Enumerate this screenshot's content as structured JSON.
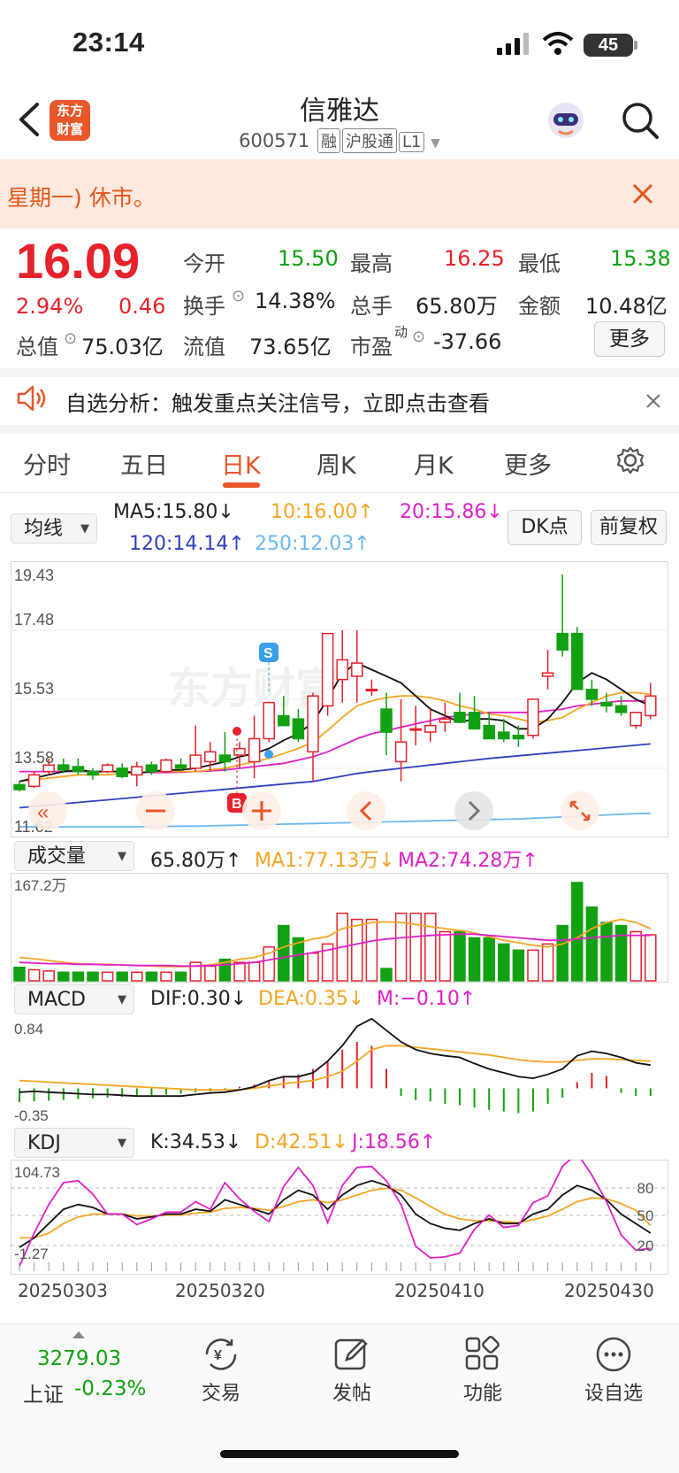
{
  "status_bar": {
    "time": "23:14",
    "battery": "45"
  },
  "header": {
    "stock_name": "信雅达",
    "stock_code": "600571",
    "tags": [
      "融",
      "沪股通",
      "L1"
    ],
    "logo_text_1": "东方",
    "logo_text_2": "财富"
  },
  "notice": {
    "text": "星期一) 休市。"
  },
  "quote": {
    "price": "16.09",
    "change_pct": "2.94%",
    "change_amt": "0.46",
    "open_label": "今开",
    "open": "15.50",
    "high_label": "最高",
    "high": "16.25",
    "low_label": "最低",
    "low": "15.38",
    "turnover_label": "换手",
    "turnover": "14.38%",
    "volume_label": "总手",
    "volume": "65.80万",
    "amount_label": "金额",
    "amount": "10.48亿",
    "mktcap_label": "总值",
    "mktcap": "75.03亿",
    "float_label": "流值",
    "float": "73.65亿",
    "pe_label": "市盈",
    "pe_sup": "动",
    "pe": "-37.66",
    "more_label": "更多"
  },
  "analysis": {
    "text": "自选分析：触发重点关注信号，立即点击查看"
  },
  "tabs": [
    "分时",
    "五日",
    "日K",
    "周K",
    "月K",
    "更多"
  ],
  "active_tab": "日K",
  "indicator_bar": {
    "selector": "均线",
    "ma5": "MA5:15.80↓",
    "ma10": "10:16.00↑",
    "ma20": "20:15.86↓",
    "ma120": "120:14.14↑",
    "ma250": "250:12.03↑",
    "dk_button": "DK点",
    "fq_button": "前复权"
  },
  "colors": {
    "up": "#e8212a",
    "down": "#12a112",
    "ma5": "#111111",
    "ma10": "#f5a623",
    "ma20": "#e020c8",
    "ma120": "#3040c0",
    "ma250": "#6cb8f0",
    "accent": "#e8562a"
  },
  "kline": {
    "y_ticks": [
      "19.43",
      "17.48",
      "15.53",
      "13.58",
      "11.62"
    ],
    "y_range": [
      11.62,
      19.43
    ],
    "markers": {
      "sell": "S",
      "buy": "B"
    }
  },
  "volume": {
    "selector": "成交量",
    "value": "65.80万↑",
    "ma1": "MA1:77.13万↓",
    "ma2": "MA2:74.28万↑",
    "max_label": "167.2万"
  },
  "macd": {
    "selector": "MACD",
    "dif": "DIF:0.30↓",
    "dea": "DEA:0.35↓",
    "m": "M:−0.10↑",
    "top": "0.84",
    "bottom": "-0.35"
  },
  "kdj": {
    "selector": "KDJ",
    "k": "K:34.53↓",
    "d": "D:42.51↓",
    "j": "J:18.56↑",
    "top": "104.73",
    "bottom": "-1.27",
    "levels": [
      "80",
      "50",
      "20"
    ]
  },
  "dates": [
    "20250303",
    "20250320",
    "20250410",
    "20250430"
  ],
  "chart_data": {
    "type": "candlestick",
    "candles": [
      [
        12.9,
        13.0,
        12.7,
        12.75
      ],
      [
        12.85,
        13.3,
        12.8,
        13.2
      ],
      [
        13.3,
        13.7,
        13.2,
        13.5
      ],
      [
        13.5,
        13.7,
        13.25,
        13.35
      ],
      [
        13.45,
        13.7,
        13.2,
        13.3
      ],
      [
        13.3,
        13.4,
        13.05,
        13.2
      ],
      [
        13.3,
        13.55,
        13.25,
        13.5
      ],
      [
        13.4,
        13.55,
        13.1,
        13.15
      ],
      [
        13.2,
        13.6,
        12.85,
        13.45
      ],
      [
        13.5,
        13.6,
        13.2,
        13.3
      ],
      [
        13.3,
        13.7,
        13.25,
        13.65
      ],
      [
        13.5,
        13.7,
        13.3,
        13.4
      ],
      [
        13.4,
        14.7,
        13.3,
        13.8
      ],
      [
        13.6,
        14.2,
        13.3,
        13.9
      ],
      [
        13.8,
        14.5,
        13.3,
        13.6
      ],
      [
        13.8,
        14.2,
        13.4,
        14.0
      ],
      [
        13.6,
        15.0,
        13.1,
        14.3
      ],
      [
        14.3,
        15.4,
        14.2,
        15.4
      ],
      [
        15.0,
        15.6,
        14.7,
        14.7
      ],
      [
        14.9,
        15.2,
        14.2,
        14.3
      ],
      [
        13.9,
        15.7,
        13.0,
        15.6
      ],
      [
        15.3,
        17.5,
        15.0,
        17.5
      ],
      [
        16.1,
        17.6,
        15.4,
        16.7
      ],
      [
        16.2,
        17.6,
        15.4,
        16.6
      ],
      [
        15.8,
        16.1,
        15.6,
        15.8
      ],
      [
        15.2,
        15.7,
        13.8,
        14.5
      ],
      [
        13.6,
        15.5,
        13.0,
        14.2
      ],
      [
        14.6,
        15.3,
        14.1,
        14.6
      ],
      [
        14.5,
        15.2,
        14.2,
        14.7
      ],
      [
        14.8,
        15.4,
        14.5,
        14.9
      ],
      [
        15.1,
        15.7,
        14.8,
        14.8
      ],
      [
        15.1,
        15.6,
        14.6,
        14.6
      ],
      [
        14.7,
        15.1,
        14.3,
        14.3
      ],
      [
        14.5,
        14.9,
        14.2,
        14.3
      ],
      [
        14.4,
        14.7,
        14.05,
        14.3
      ],
      [
        14.4,
        15.5,
        14.3,
        15.5
      ],
      [
        16.2,
        17.0,
        15.8,
        16.3
      ],
      [
        17.5,
        19.3,
        16.8,
        17.0
      ],
      [
        17.5,
        17.7,
        15.8,
        15.8
      ],
      [
        15.8,
        16.1,
        15.3,
        15.5
      ],
      [
        15.4,
        15.7,
        15.1,
        15.3
      ],
      [
        15.3,
        15.6,
        15.0,
        15.1
      ],
      [
        14.7,
        15.1,
        14.6,
        15.1
      ],
      [
        15.0,
        16.0,
        14.9,
        15.6
      ]
    ],
    "ma5": [
      13.0,
      13.1,
      13.2,
      13.3,
      13.35,
      13.3,
      13.3,
      13.3,
      13.25,
      13.3,
      13.35,
      13.35,
      13.4,
      13.5,
      13.6,
      13.75,
      13.85,
      14.0,
      14.25,
      14.45,
      14.8,
      15.5,
      16.3,
      16.6,
      16.4,
      16.2,
      16.0,
      15.6,
      15.2,
      15.0,
      14.8,
      14.9,
      14.9,
      14.85,
      14.6,
      14.6,
      14.9,
      15.4,
      16.0,
      16.3,
      16.1,
      15.8,
      15.5,
      15.3
    ],
    "ma10": [
      13.0,
      13.05,
      13.1,
      13.15,
      13.2,
      13.2,
      13.2,
      13.25,
      13.25,
      13.3,
      13.3,
      13.3,
      13.3,
      13.35,
      13.4,
      13.5,
      13.6,
      13.7,
      13.85,
      14.0,
      14.2,
      14.55,
      14.95,
      15.3,
      15.45,
      15.55,
      15.6,
      15.6,
      15.55,
      15.45,
      15.3,
      15.2,
      15.05,
      15.0,
      14.9,
      14.8,
      14.85,
      14.95,
      15.2,
      15.4,
      15.6,
      15.7,
      15.7,
      15.65
    ],
    "ma20": [
      13.3,
      13.3,
      13.3,
      13.3,
      13.3,
      13.3,
      13.3,
      13.3,
      13.28,
      13.27,
      13.27,
      13.28,
      13.3,
      13.32,
      13.35,
      13.4,
      13.45,
      13.5,
      13.55,
      13.65,
      13.75,
      13.9,
      14.1,
      14.3,
      14.45,
      14.55,
      14.65,
      14.75,
      14.85,
      14.95,
      15.0,
      15.05,
      15.1,
      15.1,
      15.1,
      15.1,
      15.15,
      15.2,
      15.3,
      15.35,
      15.4,
      15.45,
      15.45,
      15.45
    ],
    "ma120": [
      12.2,
      12.24,
      12.28,
      12.32,
      12.36,
      12.4,
      12.44,
      12.48,
      12.52,
      12.56,
      12.6,
      12.64,
      12.68,
      12.72,
      12.76,
      12.8,
      12.84,
      12.88,
      12.92,
      12.96,
      13.0,
      13.08,
      13.16,
      13.24,
      13.3,
      13.35,
      13.4,
      13.45,
      13.5,
      13.55,
      13.6,
      13.65,
      13.7,
      13.74,
      13.78,
      13.82,
      13.86,
      13.9,
      13.94,
      13.98,
      14.02,
      14.06,
      14.1,
      14.14
    ],
    "ma250": [
      11.62,
      11.62,
      11.62,
      11.62,
      11.62,
      11.62,
      11.62,
      11.62,
      11.62,
      11.63,
      11.63,
      11.64,
      11.64,
      11.65,
      11.66,
      11.67,
      11.68,
      11.69,
      11.7,
      11.71,
      11.72,
      11.73,
      11.74,
      11.75,
      11.76,
      11.77,
      11.78,
      11.79,
      11.8,
      11.81,
      11.82,
      11.83,
      11.84,
      11.85,
      11.86,
      11.88,
      11.9,
      11.92,
      11.94,
      11.96,
      11.98,
      12.0,
      12.02,
      12.03
    ],
    "volume": [
      22,
      18,
      16,
      14,
      14,
      14,
      14,
      14,
      14,
      14,
      14,
      14,
      30,
      24,
      35,
      30,
      30,
      55,
      90,
      70,
      45,
      60,
      110,
      100,
      100,
      20,
      110,
      110,
      110,
      80,
      80,
      70,
      70,
      60,
      50,
      50,
      60,
      90,
      160,
      120,
      95,
      90,
      80,
      75
    ],
    "vol_ma1": [
      38,
      36,
      33,
      30,
      28,
      27,
      27,
      26,
      25,
      24,
      23,
      23,
      24,
      26,
      30,
      35,
      38,
      45,
      55,
      62,
      68,
      72,
      85,
      90,
      95,
      96,
      95,
      92,
      88,
      85,
      82,
      78,
      72,
      66,
      62,
      58,
      55,
      60,
      70,
      85,
      95,
      100,
      95,
      85
    ],
    "vol_ma2": [
      30,
      29,
      28,
      28,
      27,
      27,
      26,
      26,
      25,
      25,
      25,
      24,
      24,
      25,
      26,
      28,
      30,
      34,
      38,
      42,
      46,
      50,
      55,
      60,
      65,
      68,
      70,
      72,
      74,
      75,
      76,
      76,
      74,
      72,
      70,
      68,
      66,
      66,
      68,
      70,
      72,
      74,
      74,
      74
    ],
    "macd_dif": [
      -0.05,
      -0.04,
      -0.05,
      -0.06,
      -0.07,
      -0.08,
      -0.08,
      -0.09,
      -0.1,
      -0.1,
      -0.1,
      -0.1,
      -0.08,
      -0.06,
      -0.05,
      -0.02,
      0.02,
      0.1,
      0.15,
      0.15,
      0.2,
      0.35,
      0.55,
      0.8,
      0.9,
      0.75,
      0.6,
      0.5,
      0.45,
      0.42,
      0.4,
      0.32,
      0.25,
      0.2,
      0.15,
      0.13,
      0.18,
      0.25,
      0.42,
      0.48,
      0.45,
      0.4,
      0.33,
      0.3
    ],
    "macd_dea": [
      0.1,
      0.09,
      0.08,
      0.07,
      0.06,
      0.05,
      0.04,
      0.03,
      0.02,
      0.01,
      0.0,
      -0.01,
      -0.02,
      -0.02,
      -0.02,
      -0.02,
      0.0,
      0.03,
      0.06,
      0.08,
      0.1,
      0.15,
      0.22,
      0.35,
      0.5,
      0.55,
      0.55,
      0.53,
      0.51,
      0.49,
      0.47,
      0.45,
      0.43,
      0.4,
      0.37,
      0.35,
      0.34,
      0.34,
      0.36,
      0.38,
      0.38,
      0.37,
      0.36,
      0.35
    ],
    "macd_hist": [
      -0.18,
      -0.17,
      -0.16,
      -0.15,
      -0.14,
      -0.13,
      -0.12,
      -0.11,
      -0.1,
      -0.09,
      -0.08,
      -0.07,
      -0.05,
      -0.04,
      -0.03,
      0.02,
      0.05,
      0.1,
      0.15,
      0.18,
      0.25,
      0.35,
      0.5,
      0.6,
      0.55,
      0.25,
      -0.1,
      -0.15,
      -0.17,
      -0.2,
      -0.22,
      -0.25,
      -0.28,
      -0.3,
      -0.32,
      -0.3,
      -0.2,
      -0.12,
      0.08,
      0.2,
      0.16,
      -0.06,
      -0.1,
      -0.1
    ],
    "kdj_k": [
      20,
      30,
      45,
      60,
      65,
      62,
      55,
      55,
      50,
      52,
      55,
      55,
      60,
      58,
      70,
      65,
      60,
      55,
      70,
      80,
      75,
      60,
      75,
      85,
      90,
      85,
      75,
      55,
      45,
      40,
      38,
      45,
      50,
      45,
      45,
      55,
      60,
      75,
      85,
      80,
      70,
      55,
      45,
      35
    ],
    "kdj_d": [
      30,
      30,
      35,
      45,
      52,
      55,
      55,
      55,
      53,
      53,
      54,
      54,
      56,
      57,
      61,
      62,
      61,
      59,
      63,
      68,
      70,
      67,
      70,
      75,
      80,
      82,
      80,
      72,
      63,
      55,
      50,
      48,
      48,
      47,
      46,
      49,
      53,
      60,
      68,
      72,
      71,
      66,
      59,
      43
    ],
    "kdj_j": [
      0,
      35,
      65,
      88,
      90,
      76,
      55,
      55,
      44,
      50,
      57,
      57,
      68,
      60,
      88,
      71,
      58,
      47,
      84,
      104,
      85,
      46,
      85,
      104,
      105,
      90,
      65,
      21,
      9,
      10,
      14,
      39,
      54,
      41,
      43,
      67,
      74,
      105,
      119,
      96,
      68,
      33,
      17,
      19
    ],
    "xlabel": "",
    "ylabel": ""
  },
  "bottom_nav": {
    "index_value": "3279.03",
    "index_name": "上证",
    "index_change": "-0.23%",
    "items": [
      {
        "label": "交易"
      },
      {
        "label": "发帖"
      },
      {
        "label": "功能"
      },
      {
        "label": "设自选"
      }
    ]
  }
}
